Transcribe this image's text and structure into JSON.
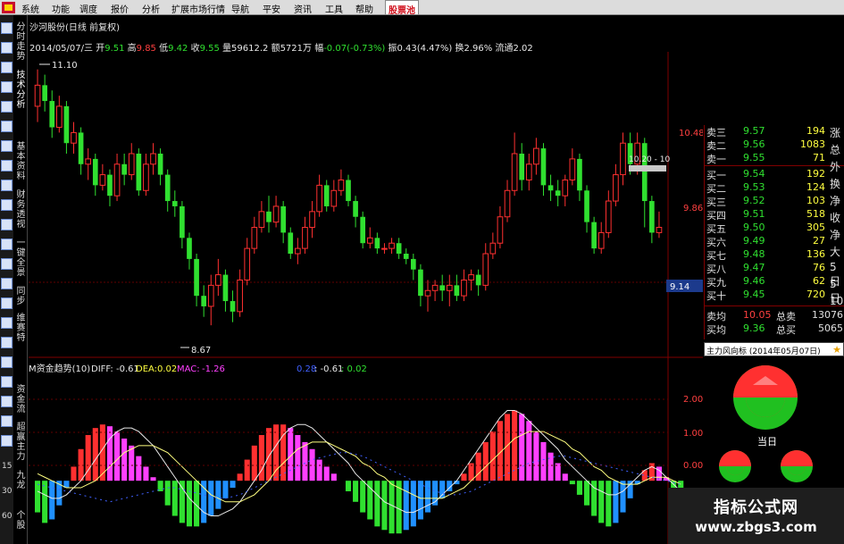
{
  "menu": {
    "items": [
      "系统",
      "功能",
      "报价",
      "分析",
      "扩展市场行情",
      "导航",
      "平安",
      "资讯",
      "工具",
      "帮助",
      "股票池"
    ],
    "partial_item": "调度",
    "active_index": 10
  },
  "left_tabs": {
    "tabs": [
      "分时走势",
      "技术分析",
      "基本资料",
      "财务透视",
      "一键全景",
      "同步",
      "维赛特"
    ],
    "flow_tabs": [
      "资金流",
      "超赢主力",
      "九龙"
    ],
    "bottom_numbers": [
      "15",
      "30",
      "60"
    ],
    "partial_tab": "个股"
  },
  "header": {
    "title": "沙河股份(日线 前复权)",
    "date": "2014/05/07/三",
    "open_label": "开",
    "open": "9.51",
    "high_label": "高",
    "high": "9.85",
    "low_label": "低",
    "low": "9.42",
    "close_label": "收",
    "close": "9.55",
    "volume_label": "量",
    "volume": "59612.2",
    "amount_label": "额",
    "amount": "5721万",
    "change_label": "幅",
    "change": "-0.07(-0.73%)",
    "amplitude_label": "振",
    "amplitude": "0.43(4.47%)",
    "turnover_label": "换",
    "turnover": "2.96%",
    "circulation_label": "流通",
    "circulation": "2.02"
  },
  "price_chart": {
    "ymin": 8.4,
    "ymax": 11.25,
    "axis_labels": [
      "10.48",
      "9.86"
    ],
    "current_price_label": "9.14",
    "max_marker": "11.10",
    "min_marker": "8.67",
    "time_marker": "10.20 - 10"
  },
  "indicator": {
    "title": "M资金趋势(10)",
    "diff_label": "DIFF:",
    "diff": "-0.61",
    "dea_label": "DEA:",
    "dea": "0.02",
    "mac_label": "MAC:",
    "mac": "-1.26",
    "extra_1": "0.28",
    "extra_2": ": -0.61",
    "extra_3": ": 0.02",
    "ymin": -1.8,
    "ymax": 2.8,
    "axis_labels": [
      "2.00",
      "1.00",
      "0.00"
    ]
  },
  "chart_data": {
    "type": "candlestick",
    "candles": [
      [
        10.75,
        10.95,
        11.1,
        10.6
      ],
      [
        10.95,
        10.8,
        11.05,
        10.7
      ],
      [
        10.8,
        10.55,
        10.9,
        10.45
      ],
      [
        10.55,
        10.75,
        10.85,
        10.5
      ],
      [
        10.75,
        10.4,
        10.8,
        10.3
      ],
      [
        10.4,
        10.5,
        10.6,
        10.3
      ],
      [
        10.5,
        10.2,
        10.55,
        10.1
      ],
      [
        10.2,
        10.25,
        10.35,
        10.05
      ],
      [
        10.25,
        10.0,
        10.3,
        9.9
      ],
      [
        10.0,
        10.1,
        10.2,
        9.95
      ],
      [
        10.1,
        9.9,
        10.15,
        9.8
      ],
      [
        9.9,
        10.2,
        10.3,
        9.85
      ],
      [
        10.2,
        10.1,
        10.3,
        10.0
      ],
      [
        10.1,
        10.3,
        10.4,
        10.05
      ],
      [
        10.3,
        9.95,
        10.35,
        9.9
      ],
      [
        9.95,
        10.2,
        10.3,
        9.9
      ],
      [
        10.2,
        10.3,
        10.4,
        10.1
      ],
      [
        10.3,
        10.1,
        10.35,
        10.0
      ],
      [
        10.1,
        9.85,
        10.15,
        9.75
      ],
      [
        9.85,
        9.8,
        9.95,
        9.7
      ],
      [
        9.8,
        9.5,
        9.85,
        9.4
      ],
      [
        9.5,
        9.3,
        9.55,
        9.2
      ],
      [
        9.3,
        8.95,
        9.35,
        8.85
      ],
      [
        8.95,
        8.85,
        9.05,
        8.75
      ],
      [
        8.85,
        9.05,
        9.15,
        8.67
      ],
      [
        9.05,
        9.15,
        9.3,
        8.95
      ],
      [
        9.15,
        8.9,
        9.2,
        8.8
      ],
      [
        8.9,
        8.8,
        9.0,
        8.7
      ],
      [
        8.8,
        9.1,
        9.2,
        8.75
      ],
      [
        9.1,
        9.4,
        9.5,
        9.05
      ],
      [
        9.4,
        9.6,
        9.7,
        9.35
      ],
      [
        9.6,
        9.75,
        9.85,
        9.55
      ],
      [
        9.75,
        9.65,
        9.9,
        9.55
      ],
      [
        9.65,
        9.8,
        9.9,
        9.6
      ],
      [
        9.8,
        9.55,
        9.85,
        9.45
      ],
      [
        9.55,
        9.35,
        9.6,
        9.3
      ],
      [
        9.35,
        9.4,
        9.5,
        9.25
      ],
      [
        9.4,
        9.6,
        9.7,
        9.35
      ],
      [
        9.6,
        9.75,
        9.85,
        9.5
      ],
      [
        9.75,
        10.0,
        10.1,
        9.7
      ],
      [
        10.0,
        9.8,
        10.05,
        9.75
      ],
      [
        9.8,
        9.95,
        10.05,
        9.75
      ],
      [
        9.95,
        10.05,
        10.15,
        9.9
      ],
      [
        10.05,
        9.85,
        10.1,
        9.8
      ],
      [
        9.85,
        9.7,
        9.9,
        9.6
      ],
      [
        9.7,
        9.45,
        9.75,
        9.4
      ],
      [
        9.45,
        9.5,
        9.6,
        9.4
      ],
      [
        9.5,
        9.4,
        9.55,
        9.35
      ],
      [
        9.4,
        9.4,
        9.45,
        9.35
      ],
      [
        9.4,
        9.45,
        9.5,
        9.35
      ],
      [
        9.45,
        9.35,
        9.5,
        9.3
      ],
      [
        9.35,
        9.3,
        9.4,
        9.25
      ],
      [
        9.3,
        9.2,
        9.35,
        9.1
      ],
      [
        9.2,
        8.95,
        9.25,
        8.85
      ],
      [
        8.95,
        9.0,
        9.1,
        8.8
      ],
      [
        9.0,
        9.05,
        9.1,
        8.9
      ],
      [
        9.05,
        9.0,
        9.15,
        8.9
      ],
      [
        9.0,
        9.05,
        9.15,
        8.85
      ],
      [
        9.05,
        8.95,
        9.15,
        8.9
      ],
      [
        8.95,
        9.1,
        9.2,
        8.9
      ],
      [
        9.1,
        9.15,
        9.2,
        9.0
      ],
      [
        9.15,
        9.05,
        9.2,
        8.95
      ],
      [
        9.05,
        9.35,
        9.45,
        9.0
      ],
      [
        9.35,
        9.45,
        9.55,
        9.3
      ],
      [
        9.45,
        9.7,
        9.8,
        9.4
      ],
      [
        9.7,
        9.95,
        10.05,
        9.65
      ],
      [
        9.95,
        10.3,
        10.5,
        9.9
      ],
      [
        10.3,
        10.05,
        10.4,
        9.95
      ],
      [
        10.05,
        10.2,
        10.3,
        9.95
      ],
      [
        10.2,
        10.35,
        10.45,
        10.1
      ],
      [
        10.35,
        10.0,
        10.4,
        9.9
      ],
      [
        10.0,
        9.95,
        10.1,
        9.85
      ],
      [
        9.95,
        9.9,
        10.05,
        9.8
      ],
      [
        9.9,
        10.05,
        10.1,
        9.8
      ],
      [
        10.05,
        10.25,
        10.35,
        10.0
      ],
      [
        10.25,
        9.95,
        10.3,
        9.85
      ],
      [
        9.95,
        9.65,
        10.0,
        9.55
      ],
      [
        9.65,
        9.4,
        9.7,
        9.35
      ],
      [
        9.4,
        9.55,
        9.65,
        9.35
      ],
      [
        9.55,
        9.85,
        9.95,
        9.5
      ],
      [
        9.85,
        10.1,
        10.2,
        9.8
      ],
      [
        10.1,
        10.4,
        10.5,
        10.0
      ],
      [
        10.4,
        10.2,
        10.5,
        10.1
      ],
      [
        10.2,
        10.4,
        10.5,
        10.1
      ],
      [
        10.4,
        9.85,
        10.45,
        9.6
      ],
      [
        9.85,
        9.55,
        9.9,
        9.45
      ],
      [
        9.55,
        9.6,
        9.75,
        9.5
      ]
    ],
    "macd": [
      -0.9,
      -1.2,
      -1.1,
      -0.7,
      -0.2,
      0.4,
      0.9,
      1.3,
      1.5,
      1.6,
      1.55,
      1.4,
      1.2,
      1.0,
      0.7,
      0.4,
      0.1,
      -0.3,
      -0.7,
      -1.0,
      -1.2,
      -1.3,
      -1.3,
      -1.2,
      -1.0,
      -0.8,
      -0.5,
      -0.2,
      0.2,
      0.6,
      1.0,
      1.3,
      1.5,
      1.6,
      1.6,
      1.5,
      1.3,
      1.1,
      0.9,
      0.6,
      0.4,
      0.2,
      0.0,
      -0.3,
      -0.6,
      -0.9,
      -1.1,
      -1.3,
      -1.4,
      -1.5,
      -1.5,
      -1.4,
      -1.3,
      -1.1,
      -0.9,
      -0.7,
      -0.5,
      -0.3,
      -0.1,
      0.2,
      0.5,
      0.8,
      1.1,
      1.4,
      1.7,
      1.9,
      2.0,
      1.9,
      1.7,
      1.4,
      1.1,
      0.8,
      0.5,
      0.2,
      -0.1,
      -0.4,
      -0.7,
      -1.0,
      -1.2,
      -1.3,
      -1.2,
      -0.9,
      -0.5,
      -0.1,
      0.3,
      0.5,
      0.4,
      0.1,
      -0.3,
      -0.6
    ],
    "diff": [
      -0.3,
      -0.4,
      -0.5,
      -0.5,
      -0.4,
      -0.2,
      0.0,
      0.3,
      0.6,
      0.9,
      1.2,
      1.4,
      1.5,
      1.5,
      1.4,
      1.2,
      1.0,
      0.7,
      0.4,
      0.1,
      -0.2,
      -0.5,
      -0.7,
      -0.9,
      -1.0,
      -1.0,
      -0.9,
      -0.8,
      -0.6,
      -0.3,
      0.0,
      0.3,
      0.7,
      1.0,
      1.3,
      1.5,
      1.6,
      1.6,
      1.5,
      1.3,
      1.1,
      0.9,
      0.7,
      0.5,
      0.2,
      0.0,
      -0.2,
      -0.4,
      -0.6,
      -0.7,
      -0.8,
      -0.9,
      -0.9,
      -0.8,
      -0.7,
      -0.6,
      -0.4,
      -0.2,
      0.0,
      0.3,
      0.6,
      0.9,
      1.2,
      1.5,
      1.8,
      2.0,
      2.0,
      1.9,
      1.7,
      1.5,
      1.3,
      1.1,
      0.9,
      0.6,
      0.4,
      0.2,
      0.0,
      -0.2,
      -0.3,
      -0.4,
      -0.4,
      -0.3,
      -0.1,
      0.1,
      0.3,
      0.4,
      0.3,
      0.1,
      -0.1,
      -0.3
    ],
    "dea": [
      0.2,
      0.1,
      0.0,
      -0.1,
      -0.2,
      -0.2,
      -0.2,
      -0.1,
      0.0,
      0.2,
      0.4,
      0.6,
      0.8,
      0.9,
      1.0,
      1.0,
      1.0,
      0.9,
      0.8,
      0.6,
      0.4,
      0.2,
      0.0,
      -0.2,
      -0.4,
      -0.5,
      -0.6,
      -0.6,
      -0.6,
      -0.5,
      -0.4,
      -0.2,
      0.0,
      0.3,
      0.5,
      0.7,
      0.9,
      1.0,
      1.1,
      1.1,
      1.1,
      1.0,
      0.9,
      0.8,
      0.7,
      0.5,
      0.4,
      0.2,
      0.1,
      -0.1,
      -0.2,
      -0.3,
      -0.4,
      -0.5,
      -0.5,
      -0.5,
      -0.5,
      -0.4,
      -0.3,
      -0.2,
      0.0,
      0.2,
      0.4,
      0.6,
      0.8,
      1.0,
      1.2,
      1.3,
      1.4,
      1.4,
      1.4,
      1.3,
      1.2,
      1.1,
      0.9,
      0.8,
      0.6,
      0.4,
      0.3,
      0.1,
      0.0,
      -0.1,
      -0.1,
      -0.1,
      0.0,
      0.1,
      0.1,
      0.1,
      0.0,
      -0.1
    ],
    "trend": [
      -0.1,
      -0.15,
      -0.2,
      -0.25,
      -0.3,
      -0.35,
      -0.4,
      -0.45,
      -0.5,
      -0.55,
      -0.6,
      -0.55,
      -0.5,
      -0.45,
      -0.4,
      -0.35,
      -0.3,
      -0.25,
      -0.2,
      -0.2,
      -0.25,
      -0.3,
      -0.35,
      -0.4,
      -0.45,
      -0.5,
      -0.5,
      -0.45,
      -0.4,
      -0.3,
      -0.2,
      -0.1,
      0.0,
      0.1,
      0.2,
      0.3,
      0.4,
      0.5,
      0.6,
      0.65,
      0.7,
      0.75,
      0.8,
      0.8,
      0.75,
      0.7,
      0.6,
      0.5,
      0.4,
      0.3,
      0.2,
      0.1,
      0.0,
      -0.1,
      -0.2,
      -0.3,
      -0.35,
      -0.4,
      -0.4,
      -0.35,
      -0.3,
      -0.2,
      -0.1,
      0.0,
      0.1,
      0.2,
      0.3,
      0.4,
      0.5,
      0.55,
      0.6,
      0.65,
      0.7,
      0.7,
      0.65,
      0.6,
      0.55,
      0.5,
      0.45,
      0.4,
      0.35,
      0.3,
      0.25,
      0.2,
      0.15,
      0.1,
      0.05,
      0.0,
      -0.05,
      -0.1
    ]
  },
  "order_book": {
    "sells": [
      {
        "label": "卖三",
        "price": "9.57",
        "volume": "194"
      },
      {
        "label": "卖二",
        "price": "9.56",
        "volume": "1083"
      },
      {
        "label": "卖一",
        "price": "9.55",
        "volume": "71"
      }
    ],
    "buys": [
      {
        "label": "买一",
        "price": "9.54",
        "volume": "192"
      },
      {
        "label": "买二",
        "price": "9.53",
        "volume": "124"
      },
      {
        "label": "买三",
        "price": "9.52",
        "volume": "103"
      },
      {
        "label": "买四",
        "price": "9.51",
        "volume": "518"
      },
      {
        "label": "买五",
        "price": "9.50",
        "volume": "305"
      },
      {
        "label": "买六",
        "price": "9.49",
        "volume": "27"
      },
      {
        "label": "买七",
        "price": "9.48",
        "volume": "136"
      },
      {
        "label": "买八",
        "price": "9.47",
        "volume": "76"
      },
      {
        "label": "买九",
        "price": "9.46",
        "volume": "62"
      },
      {
        "label": "买十",
        "price": "9.45",
        "volume": "720"
      }
    ],
    "avg_sell_label": "卖均",
    "avg_sell_price": "10.05",
    "total_sell_label": "总卖",
    "total_sell": "13076",
    "avg_buy_label": "买均",
    "avg_buy_price": "9.36",
    "total_buy_label": "总买",
    "total_buy": "5065"
  },
  "right_strip": [
    "涨",
    "总",
    "外",
    "换",
    "净",
    "收",
    "净",
    "大",
    "5日",
    "5日",
    "10"
  ],
  "flow_panel": {
    "title": "主力风向标 (2014年05月07日)",
    "today_label": "当日",
    "colors": {
      "inflow": "#ff3030",
      "outflow": "#20c020"
    }
  },
  "watermark": {
    "line1": "指标公式网",
    "line2": "www.zbgs3.com"
  }
}
